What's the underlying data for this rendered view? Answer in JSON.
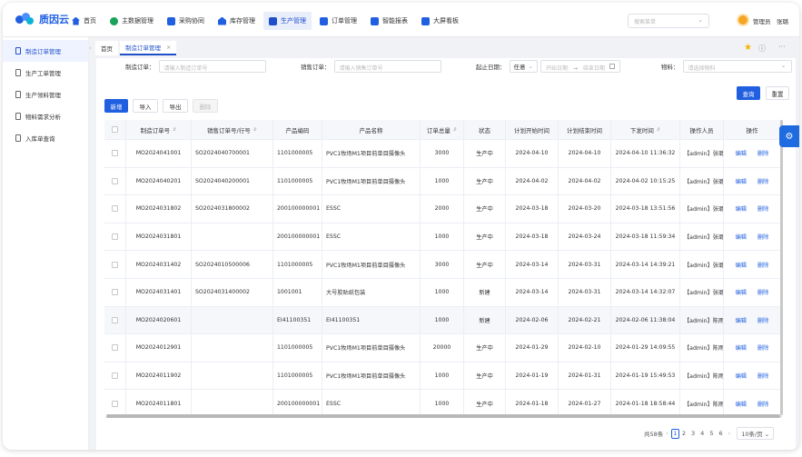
{
  "app": {
    "logo_text": "质因云"
  },
  "nav": [
    {
      "label": "首页",
      "color": "#1f5fe0",
      "active": false
    },
    {
      "label": "主数据管理",
      "color": "#19a35a",
      "active": false
    },
    {
      "label": "采购协同",
      "color": "#1f5fe0",
      "active": false
    },
    {
      "label": "库存管理",
      "color": "#1f5fe0",
      "active": false
    },
    {
      "label": "生产管理",
      "color": "#1f5fe0",
      "active": true
    },
    {
      "label": "订单管理",
      "color": "#1f5fe0",
      "active": false
    },
    {
      "label": "智能报表",
      "color": "#1f5fe0",
      "active": false
    },
    {
      "label": "大屏看板",
      "color": "#1f5fe0",
      "active": false
    }
  ],
  "header": {
    "search_placeholder": "搜索菜单",
    "user_role": "管理员",
    "user_name": "张璐"
  },
  "sidebar": {
    "items": [
      {
        "label": "制造订单管理",
        "active": true
      },
      {
        "label": "生产工单管理",
        "active": false
      },
      {
        "label": "生产领料管理",
        "active": false
      },
      {
        "label": "物料需求分析",
        "active": false
      },
      {
        "label": "入库单查询",
        "active": false
      }
    ]
  },
  "tabs": [
    {
      "label": "首页",
      "active": false
    },
    {
      "label": "制造订单管理",
      "active": true
    }
  ],
  "filters": {
    "mo_label": "制造订单：",
    "mo_placeholder": "请输入制造订单号",
    "so_label": "销售订单：",
    "so_placeholder": "请输入销售订单号",
    "date_label": "起止日期：",
    "date_mode": "任意",
    "start_placeholder": "开始日期",
    "date_sep": "→",
    "end_placeholder": "结束日期",
    "material_label": "物料：",
    "material_placeholder": "请选择物料",
    "query_button": "查询",
    "reset_button": "重置"
  },
  "toolbar": {
    "add": "新增",
    "import": "导入",
    "export": "导出",
    "delete": "删除"
  },
  "table": {
    "headers": [
      "制造订单号",
      "销售订单号/行号",
      "产品编码",
      "产品名称",
      "订单总量",
      "状态",
      "计划开始时间",
      "计划结束时间",
      "下发时间",
      "操作人员",
      "操作"
    ],
    "edit_label": "编辑",
    "delete_label": "删除",
    "rows": [
      [
        "MO2024041001",
        "SO2024040700001",
        "1101000005",
        "PVC1牧场M1项目前单目摄像头",
        "3000",
        "生产中",
        "2024-04-10",
        "2024-04-10",
        "2024-04-10 11:36:32",
        "【admin】张璐"
      ],
      [
        "MO2024040201",
        "SO2024040200001",
        "1101000005",
        "PVC1牧场M1项目前单目摄像头",
        "1000",
        "生产中",
        "2024-04-02",
        "2024-04-02",
        "2024-04-02 10:15:25",
        "【admin】张璐"
      ],
      [
        "MO2024031802",
        "SO2024031800002",
        "200100000001",
        "ESSC",
        "2000",
        "生产中",
        "2024-03-18",
        "2024-03-20",
        "2024-03-18 13:51:56",
        "【admin】张璐"
      ],
      [
        "MO2024031801",
        "",
        "200100000001",
        "ESSC",
        "1000",
        "生产中",
        "2024-03-18",
        "2024-03-24",
        "2024-03-18 11:59:34",
        "【admin】张璐"
      ],
      [
        "MO2024031402",
        "SO2024010500006",
        "1101000005",
        "PVC1牧场M1项目前单目摄像头",
        "3000",
        "生产中",
        "2024-03-14",
        "2024-03-31",
        "2024-03-14 14:39:21",
        "【admin】张璐"
      ],
      [
        "MO2024031401",
        "SO2024031400002",
        "1001001",
        "大号胶贴纸包装",
        "1000",
        "新建",
        "2024-03-14",
        "2024-03-31",
        "2024-03-14 14:32:07",
        "【admin】张璐"
      ],
      [
        "MO2024020601",
        "",
        "EI41100351",
        "EI41100351",
        "1000",
        "新建",
        "2024-02-06",
        "2024-02-21",
        "2024-02-06 11:38:04",
        "【admin】陈雨杰"
      ],
      [
        "MO2024012901",
        "",
        "1101000005",
        "PVC1牧场M1项目前单目摄像头",
        "20000",
        "生产中",
        "2024-01-29",
        "2024-02-10",
        "2024-01-29 14:09:55",
        "【admin】陈雨杰"
      ],
      [
        "MO2024011902",
        "",
        "1101000005",
        "PVC1牧场M1项目前单目摄像头",
        "1000",
        "生产中",
        "2024-01-19",
        "2024-01-31",
        "2024-01-19 15:49:53",
        "【admin】陈雨杰"
      ],
      [
        "MO2024011801",
        "",
        "200100000001",
        "ESSC",
        "1000",
        "生产中",
        "2024-01-18",
        "2024-01-27",
        "2024-01-18 18:58:44",
        "【admin】陈雨杰"
      ]
    ]
  },
  "pagination": {
    "total": "共58条",
    "pages": [
      "1",
      "2",
      "3",
      "4",
      "5",
      "6"
    ],
    "current": "1",
    "page_size": "10条/页"
  }
}
